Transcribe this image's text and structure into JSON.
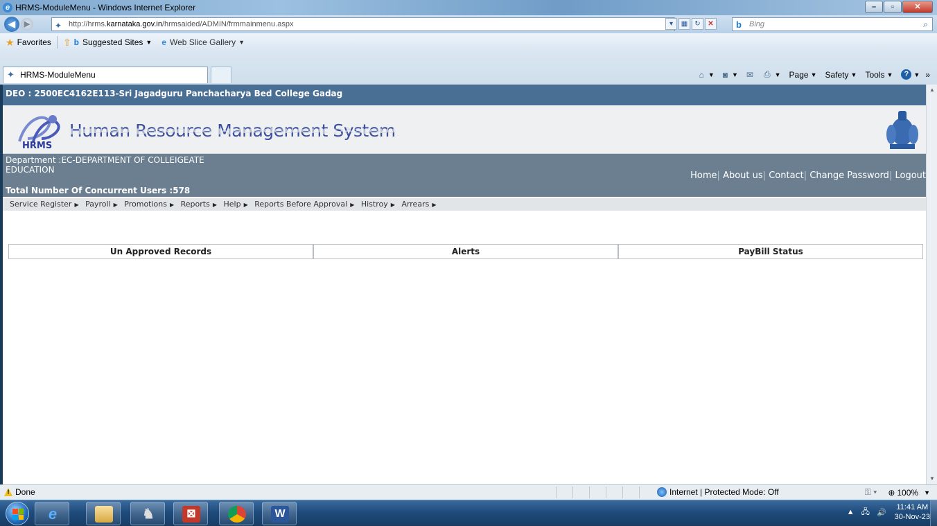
{
  "window": {
    "title": "HRMS-ModuleMenu - Windows Internet Explorer"
  },
  "address": {
    "prefix": "http://hrms.",
    "domain": "karnataka.gov.in",
    "path": "/hrmsaided/ADMIN/frmmainmenu.aspx"
  },
  "search": {
    "placeholder": "Bing",
    "logo": "b"
  },
  "favorites": {
    "label": "Favorites",
    "items": [
      {
        "label": "Suggested Sites",
        "icon": "bing-icon"
      },
      {
        "label": "Web Slice Gallery",
        "icon": "ie-icon"
      }
    ]
  },
  "tab": {
    "label": "HRMS-ModuleMenu"
  },
  "commandbar": {
    "page": "Page",
    "safety": "Safety",
    "tools": "Tools"
  },
  "page": {
    "deo": "DEO : 2500EC4162E113-Sri Jagadguru Panchacharya Bed College Gadag",
    "system_title": "Human Resource Management System",
    "logo_text": "HRMS",
    "department": "Department :EC-DEPARTMENT OF COLLEIGEATE EDUCATION",
    "concurrent_users": "Total Number Of Concurrent Users :578",
    "top_links": [
      "Home",
      "About us",
      "Contact",
      "Change Password",
      "Logout"
    ],
    "menu": [
      "Service Register",
      "Payroll",
      "Promotions",
      "Reports",
      "Help",
      "Reports Before Approval",
      "Histroy",
      "Arrears"
    ],
    "panels": [
      "Un Approved Records",
      "Alerts",
      "PayBill Status"
    ]
  },
  "status": {
    "text": "Done",
    "zone": "Internet | Protected Mode: Off",
    "zoom": "100%"
  },
  "taskbar": {
    "time": "11:41 AM",
    "date": "30-Nov-23"
  },
  "colors": {
    "deo_bar": "#4a6f95",
    "dept_bar": "#6b7f91",
    "title_blue": "#3b4f9e"
  }
}
